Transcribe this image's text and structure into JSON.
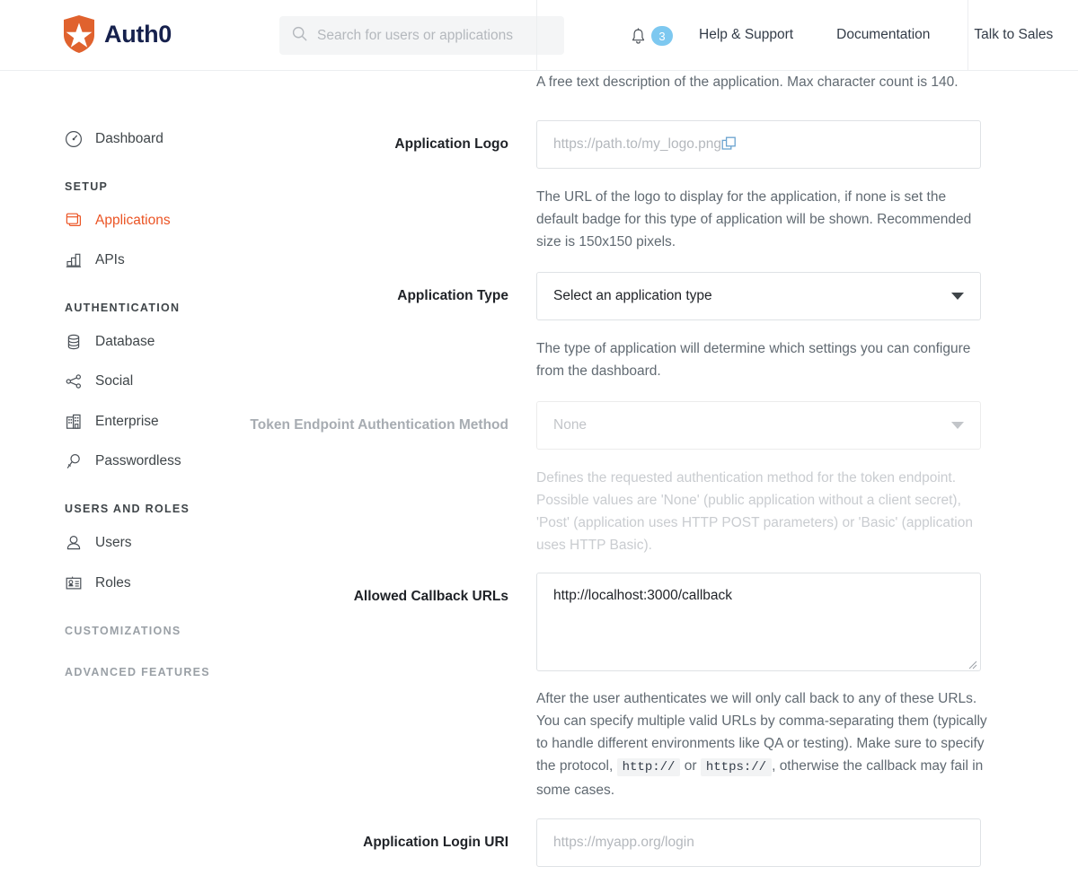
{
  "brand": {
    "name": "Auth0",
    "logo_icon": "auth0-shield-star-icon",
    "logo_color": "#e0622e"
  },
  "header": {
    "search": {
      "icon": "search-icon",
      "placeholder": "Search for users or applications",
      "value": ""
    },
    "notifications": {
      "icon": "bell-icon",
      "count": "3",
      "badge_color": "#7dc8f0"
    },
    "links": [
      {
        "label": "Help & Support"
      },
      {
        "label": "Documentation"
      },
      {
        "label": "Talk to Sales"
      }
    ]
  },
  "sidebar": {
    "items": [
      {
        "label": "Dashboard",
        "icon": "speedometer-icon",
        "type": "item",
        "active": false
      },
      {
        "label": "SETUP",
        "type": "header",
        "muted": false
      },
      {
        "label": "Applications",
        "icon": "applications-windows-icon",
        "type": "item",
        "active": true
      },
      {
        "label": "APIs",
        "icon": "bar-chart-icon",
        "type": "item",
        "active": false
      },
      {
        "label": "AUTHENTICATION",
        "type": "header",
        "muted": false
      },
      {
        "label": "Database",
        "icon": "database-cylinder-icon",
        "type": "item",
        "active": false
      },
      {
        "label": "Social",
        "icon": "share-nodes-icon",
        "type": "item",
        "active": false
      },
      {
        "label": "Enterprise",
        "icon": "building-icon",
        "type": "item",
        "active": false
      },
      {
        "label": "Passwordless",
        "icon": "key-icon",
        "type": "item",
        "active": false
      },
      {
        "label": "USERS AND ROLES",
        "type": "header",
        "muted": false
      },
      {
        "label": "Users",
        "icon": "user-bust-icon",
        "type": "item",
        "active": false
      },
      {
        "label": "Roles",
        "icon": "id-card-icon",
        "type": "item",
        "active": false
      },
      {
        "label": "CUSTOMIZATIONS",
        "type": "header",
        "muted": true
      },
      {
        "label": "ADVANCED FEATURES",
        "type": "header",
        "muted": true
      }
    ],
    "active_color": "#eb5424"
  },
  "form": {
    "description_hint": "A free text description of the application. Max character count is 140.",
    "application_logo": {
      "label": "Application Logo",
      "placeholder": "https://path.to/my_logo.png",
      "value": "",
      "copy_icon": "copy-icon",
      "hint": "The URL of the logo to display for the application, if none is set the default badge for this type of application will be shown. Recommended size is 150x150 pixels."
    },
    "application_type": {
      "label": "Application Type",
      "selected": "Select an application type",
      "hint": "The type of application will determine which settings you can configure from the dashboard."
    },
    "token_endpoint_auth_method": {
      "label": "Token Endpoint Authentication Method",
      "selected": "None",
      "disabled": true,
      "hint": "Defines the requested authentication method for the token endpoint. Possible values are 'None' (public application without a client secret), 'Post' (application uses HTTP POST parameters) or 'Basic' (application uses HTTP Basic)."
    },
    "allowed_callback_urls": {
      "label": "Allowed Callback URLs",
      "value": "http://localhost:3000/callback",
      "hint_part1": "After the user authenticates we will only call back to any of these URLs. You can specify multiple valid URLs by comma-separating them (typically to handle different environments like QA or testing). Make sure to specify the protocol,",
      "hint_code1": "http://",
      "hint_or": "or",
      "hint_code2": "https://",
      "hint_part2": ", otherwise the callback may fail in some cases."
    },
    "application_login_uri": {
      "label": "Application Login URI",
      "placeholder": "https://myapp.org/login",
      "value": ""
    }
  }
}
